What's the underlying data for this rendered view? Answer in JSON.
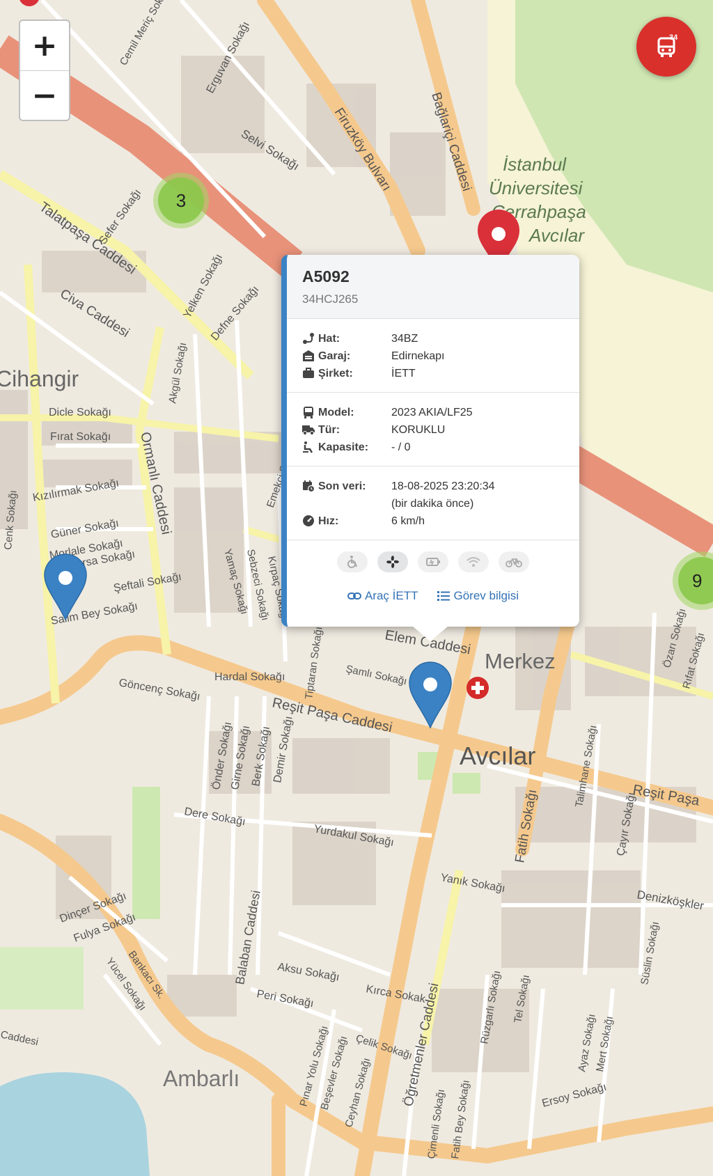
{
  "map": {
    "place_labels": [
      "Cihangir",
      "Merkez",
      "Avcılar",
      "Ambarlı",
      "İstanbul",
      "Üniversitesi",
      "Cerrahpaşa",
      "Avcılar"
    ],
    "street_labels": [
      "Firuzköy Bulvarı",
      "Bağlariçi Caddesi",
      "Selvi Sokağı",
      "Erguvan Sokağı",
      "Cemil Meriç Sokağı",
      "Talatpaşa Caddesi",
      "Sefer Sokağı",
      "Civa Caddesi",
      "Yelken Sokağı",
      "Defne Sokağı",
      "Dicle Sokağı",
      "Fırat Sokağı",
      "Kızılırmak Sokağı",
      "Güner Sokağı",
      "Morlale Sokağı",
      "Bursa Sokağı",
      "Şeftali Sokağı",
      "Salim Bey Sokağı",
      "Ormanlı Caddesi",
      "Akgül Sokağı",
      "Göncenç Sokağı",
      "Hardal Sokağı",
      "Reşit Paşa Caddesi",
      "Şamlı Sokağı",
      "Tiptaran Sokağı",
      "Yamaç Sokağı",
      "Sebzeci Sokağı",
      "Kırpaç Sokağı",
      "Emekçi Sokağı",
      "Önder Sokağı",
      "Girne Sokağı",
      "Berk Sokağı",
      "Demir Sokağı",
      "Dere Sokağı",
      "Yurdakul Sokağı",
      "Fatih Sokağı",
      "Talimhane Sokağı",
      "Reşit Paşa",
      "Yanık Sokağı",
      "Çayır Sokağı",
      "Denizköşkler",
      "Süslin Sokağı",
      "Dinçer Sokağı",
      "Fulya Sokağı",
      "Bankacı Sk.",
      "Yücel Sokağı",
      "Balaban Caddesi",
      "Aksu Sokağı",
      "Peri Sokağı",
      "Kırca Sokak",
      "Öğretmenler Caddesi",
      "Rüzgarlı Sokağı",
      "Tel Sokağı",
      "Çelik Sokağı",
      "Pınar Yolu Sokağı",
      "Beşevler Sokağı",
      "Ceyhan Sokağı",
      "Çimenli Sokağı",
      "Fatih Bey Sokağı",
      "Ersoy Sokağı",
      "Mert Sokağı",
      "Ayaz Sokağı",
      "Özarı Sokağı",
      "Rıfat Sokağı",
      "Cenk Sokağı",
      "Caddesi",
      "Elem Caddesi"
    ],
    "clusters": [
      {
        "count": "3"
      },
      {
        "count": "9"
      }
    ],
    "colors": {
      "primary_road": "#f5c98d",
      "highway": "#e8927a",
      "park": "#cde8b0",
      "water": "#a9d3df",
      "cluster": "#8bc84a",
      "pin_blue": "#3b82c4",
      "pin_red": "#d9302c"
    }
  },
  "controls": {
    "zoom_in": "+",
    "zoom_out": "−",
    "bus_fab_badge": "34",
    "bus_fab_icon": "bus-icon"
  },
  "popup": {
    "vehicle_code": "A5092",
    "plate": "34HCJ265",
    "hat_label": "Hat:",
    "hat_value": "34BZ",
    "garaj_label": "Garaj:",
    "garaj_value": "Edirnekapı",
    "sirket_label": "Şirket:",
    "sirket_value": "İETT",
    "model_label": "Model:",
    "model_value": "2023 AKIA/LF25",
    "tur_label": "Tür:",
    "tur_value": "KORUKLU",
    "kapasite_label": "Kapasite:",
    "kapasite_value": "- / 0",
    "sonveri_label": "Son veri:",
    "sonveri_value": "18-08-2025 23:20:34",
    "sonveri_relative": "(bir dakika önce)",
    "hiz_label": "Hız:",
    "hiz_value": "6 km/h",
    "features": [
      "wheelchair-icon",
      "fan-icon",
      "usb-charge-icon",
      "wifi-icon",
      "bicycle-icon"
    ],
    "link_arac": "Araç İETT",
    "link_gorev": "Görev bilgisi"
  }
}
